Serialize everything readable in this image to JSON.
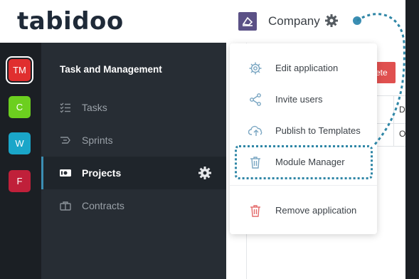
{
  "brand": {
    "logo_text": "tabidoo"
  },
  "header": {
    "company_label": "Company"
  },
  "apps": [
    {
      "label": "TM",
      "color": "#e02f2f",
      "active": true
    },
    {
      "label": "C",
      "color": "#6ccf1f",
      "active": false
    },
    {
      "label": "W",
      "color": "#1aa6c9",
      "active": false
    },
    {
      "label": "F",
      "color": "#c0203a",
      "active": false
    }
  ],
  "sidebar": {
    "title": "Task and Management",
    "items": [
      {
        "label": "Tasks",
        "icon": "list-check-icon"
      },
      {
        "label": "Sprints",
        "icon": "sprint-icon"
      },
      {
        "label": "Projects",
        "icon": "projects-icon",
        "active": true
      },
      {
        "label": "Contracts",
        "icon": "briefcase-icon"
      }
    ]
  },
  "content": {
    "delete_label": "ete",
    "col_letter": "D",
    "row_letter": "O"
  },
  "menu": {
    "items": [
      {
        "label": "Edit application",
        "icon": "gear-icon"
      },
      {
        "label": "Invite users",
        "icon": "share-icon"
      },
      {
        "label": "Publish to Templates",
        "icon": "cloud-upload-icon"
      },
      {
        "label": "Module Manager",
        "icon": "trash-icon"
      },
      {
        "label": "Remove application",
        "icon": "trash-red-icon"
      }
    ]
  },
  "colors": {
    "accent": "#3b8eb3",
    "sidebar": "#272d34",
    "rail": "#1b1f24",
    "danger": "#e0504f"
  }
}
